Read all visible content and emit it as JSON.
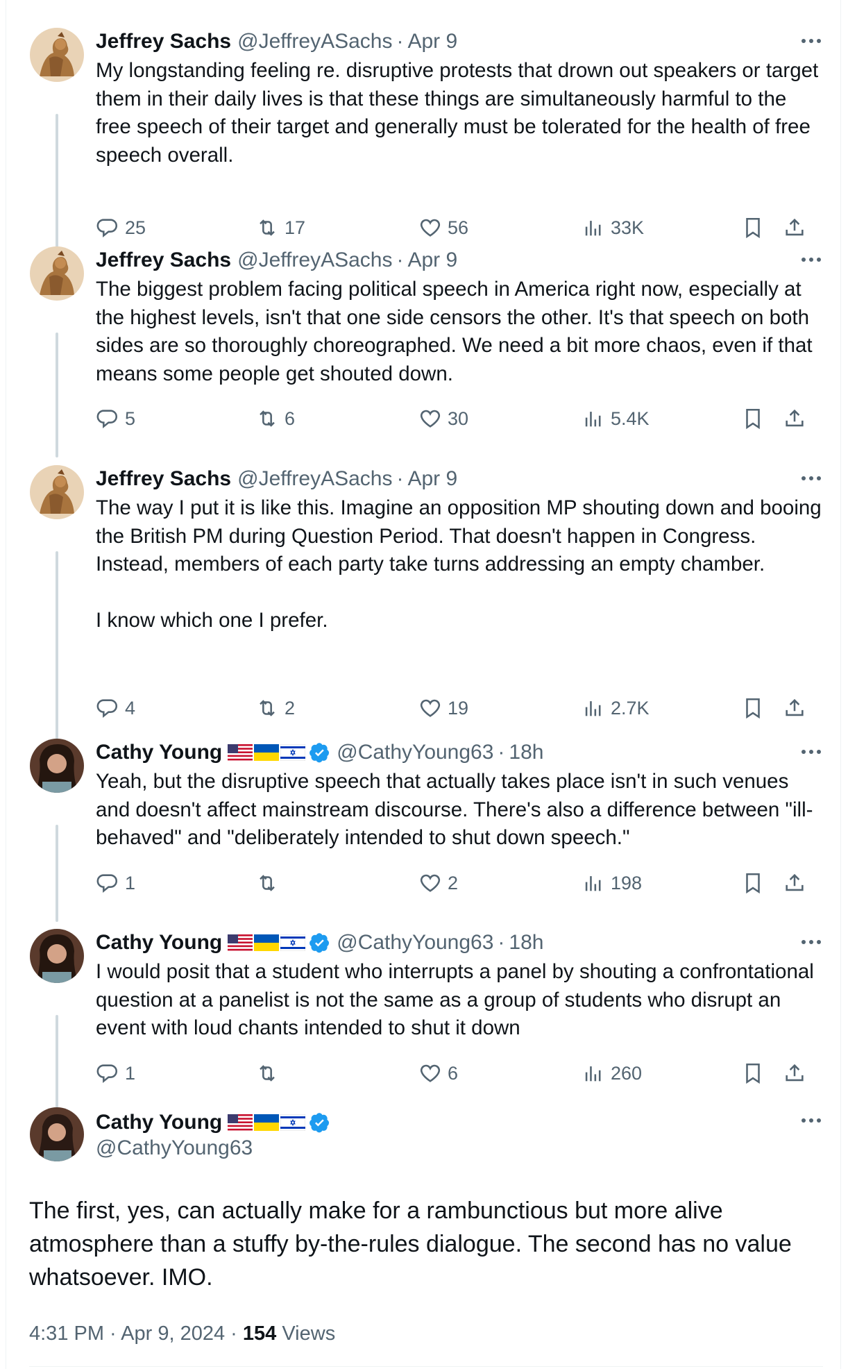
{
  "tweets": [
    {
      "name": "Jeffrey Sachs",
      "handle": "@JeffreyASachs",
      "time": "Apr 9",
      "text": "My longstanding feeling re. disruptive protests that drown out speakers or target them in their daily lives is that these things are simultaneously harmful to the free speech of their target and generally must be tolerated for the health of free speech overall.",
      "replies": "25",
      "retweets": "17",
      "likes": "56",
      "views": "33K"
    },
    {
      "name": "Jeffrey Sachs",
      "handle": "@JeffreyASachs",
      "time": "Apr 9",
      "text": "The biggest problem facing political speech in America right now, especially at the highest levels, isn't that one side censors the other. It's that speech on both sides are so thoroughly choreographed. We need a bit more chaos, even if that means some people get shouted down.",
      "replies": "5",
      "retweets": "6",
      "likes": "30",
      "views": "5.4K"
    },
    {
      "name": "Jeffrey Sachs",
      "handle": "@JeffreyASachs",
      "time": "Apr 9",
      "text": "The way I put it is like this. Imagine an opposition MP shouting down and booing the British PM during Question Period. That doesn't happen in Congress. Instead, members of each party take turns addressing an empty chamber.\n\nI know which one I prefer.",
      "replies": "4",
      "retweets": "2",
      "likes": "19",
      "views": "2.7K"
    },
    {
      "name": "Cathy Young",
      "handle": "@CathyYoung63",
      "time": "18h",
      "text": "Yeah, but the disruptive speech that actually takes place isn't in such venues and doesn't affect mainstream discourse. There's also a difference between \"ill-behaved\" and \"deliberately intended to shut down speech.\"",
      "replies": "1",
      "retweets": "",
      "likes": "2",
      "views": "198"
    },
    {
      "name": "Cathy Young",
      "handle": "@CathyYoung63",
      "time": "18h",
      "text": "I would posit that a student who interrupts a panel by shouting a confrontational question at a panelist is not the same as a group of students who disrupt an event with loud chants intended to shut it down",
      "replies": "1",
      "retweets": "",
      "likes": "6",
      "views": "260"
    }
  ],
  "main": {
    "name": "Cathy Young",
    "handle": "@CathyYoung63",
    "text": "The first, yes, can actually make for a rambunctious but more alive atmosphere than a stuffy by-the-rules dialogue. The second has no value whatsoever. IMO.",
    "time": "4:31 PM",
    "date": "Apr 9, 2024",
    "views_count": "154",
    "views_label": "Views"
  },
  "colors": {
    "text": "#0f1419",
    "secondary": "#536471",
    "verified": "#1d9bf0",
    "thread_line": "#cfd9de"
  },
  "icons": [
    "reply-icon",
    "retweet-icon",
    "like-icon",
    "views-icon",
    "bookmark-icon",
    "share-icon",
    "more-icon",
    "verified-badge-icon"
  ]
}
